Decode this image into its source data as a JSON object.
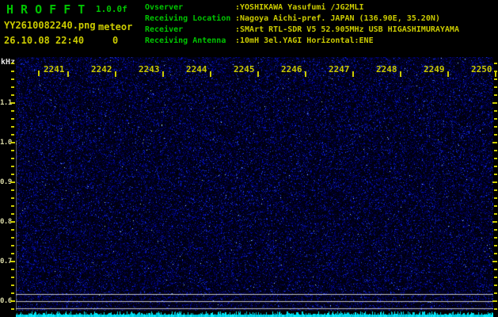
{
  "header": {
    "app_title": "H R O F F T",
    "version": "1.0.0f",
    "filename": "YY2610082240.png",
    "mode": "meteor",
    "datetime": "26.10.08 22:40",
    "count": "0",
    "info_rows": [
      {
        "label": "Ovserver",
        "value": ":YOSHIKAWA Yasufumi /JG2MLI"
      },
      {
        "label": "Receiving Location",
        "value": ":Nagoya Aichi-pref. JAPAN (136.90E, 35.20N)"
      },
      {
        "label": "Receiver",
        "value": ":SMArt RTL-SDR V5 52.905MHz USB HIGASHIMURAYAMA"
      },
      {
        "label": "Receiving Antenna",
        "value": ":10mH 3el.YAGI Horizontal:ENE"
      }
    ]
  },
  "chart_data": {
    "type": "heatmap",
    "subtype": "radio-meteor-spectrogram-waterfall",
    "unit_label": "kHz",
    "time_labels": [
      "2241",
      "2242",
      "2243",
      "2244",
      "2245",
      "2246",
      "2247",
      "2248",
      "2249",
      "2250"
    ],
    "freq_tick_labels": [
      "1.1",
      "1.0",
      "0.9",
      "0.8",
      "0.7",
      "0.6"
    ],
    "ylim_khz": [
      0.56,
      1.22
    ],
    "minor_tick_step_khz": 0.02,
    "reference_lines_khz": [
      0.62,
      0.6,
      0.58
    ],
    "meteor_count": 0,
    "content": "uniform blue background noise speckle, no meteor echoes; cyan signal-level strip along bottom edge",
    "legend_position": "none",
    "grid": false
  },
  "colors": {
    "background": "#000000",
    "green_text": "#00c400",
    "yellow_text": "#cbcb00",
    "pale_freq_label": "#d9d9a6",
    "white_label": "#e6e6e6",
    "noise_blue": "#2323bb",
    "strip_cyan": "#00e4f6",
    "grid_gray": "#c3c3c3"
  }
}
